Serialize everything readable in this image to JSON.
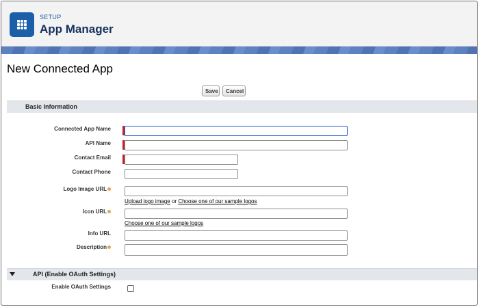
{
  "header": {
    "setup_label": "SETUP",
    "app_title": "App Manager",
    "icon": "app-launcher-grid-icon",
    "accent_color": "#1b5fa8"
  },
  "page": {
    "title": "New Connected App"
  },
  "toolbar": {
    "save_label": "Save",
    "cancel_label": "Cancel"
  },
  "basic_info": {
    "section_title": "Basic Information",
    "fields": {
      "app_name": {
        "label": "Connected App Name",
        "value": "",
        "required": true
      },
      "api_name": {
        "label": "API Name",
        "value": "",
        "required": true
      },
      "contact_email": {
        "label": "Contact Email",
        "value": "",
        "required": true
      },
      "contact_phone": {
        "label": "Contact Phone",
        "value": ""
      },
      "logo_url": {
        "label": "Logo Image URL",
        "value": ""
      },
      "icon_url": {
        "label": "Icon URL",
        "value": ""
      },
      "info_url": {
        "label": "Info URL",
        "value": ""
      },
      "description": {
        "label": "Description",
        "value": ""
      }
    },
    "logo_links": {
      "upload": "Upload logo image",
      "or": "or",
      "sample": "Choose one of our sample logos"
    },
    "icon_links": {
      "sample": "Choose one of our sample logos"
    }
  },
  "api_section": {
    "section_title": "API (Enable OAuth Settings)",
    "enable_oauth_label": "Enable OAuth Settings",
    "enable_oauth_checked": false
  }
}
